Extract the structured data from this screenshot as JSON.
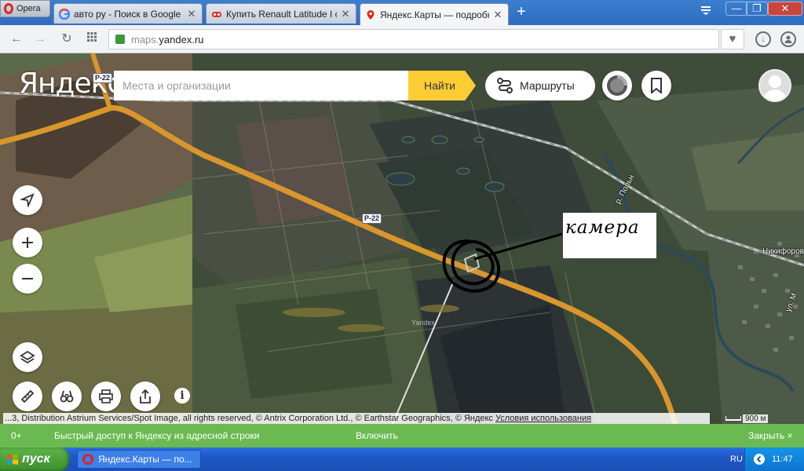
{
  "browser": {
    "opera_label": "Opera",
    "tabs": [
      {
        "title": "авто ру - Поиск в Google",
        "favicon": "google-icon"
      },
      {
        "title": "Купить Renault Latitude I с",
        "favicon": "auto-ru-icon"
      },
      {
        "title": "Яндекс.Карты — подробна",
        "favicon": "yandex-maps-pin-icon"
      }
    ],
    "url_grey": "maps.",
    "url_dark": "yandex.ru"
  },
  "map": {
    "logo": "Яндекс",
    "search_placeholder": "Места и организации",
    "find_label": "Найти",
    "routes_label": "Маршруты",
    "road_labels": [
      "Р-22",
      "Р-22"
    ],
    "place_labels": [
      "Никифоров",
      "р. Польн",
      "ул. М"
    ],
    "annotation": "камера",
    "watermark": "Yandex",
    "copyright_text": "...3, Distribution Astrium Services/Spot Image, all rights reserved, © Antrix Corporation Ltd., © Earthstar Geographics, © Яндекс ",
    "terms_link": "Условия использования",
    "scale": "900 м",
    "info": "i"
  },
  "notification": {
    "count": "0+",
    "message": "Быстрый доступ к Яндексу из адресной строки",
    "enable": "Включить",
    "close": "Закрыть ×"
  },
  "taskbar": {
    "start": "пуск",
    "item": "Яндекс.Карты — по...",
    "lang": "RU",
    "time": "11:47"
  },
  "colors": {
    "accent_yellow": "#ffcc33",
    "notify_green": "#6aba51",
    "road_orange": "#d9962c"
  }
}
